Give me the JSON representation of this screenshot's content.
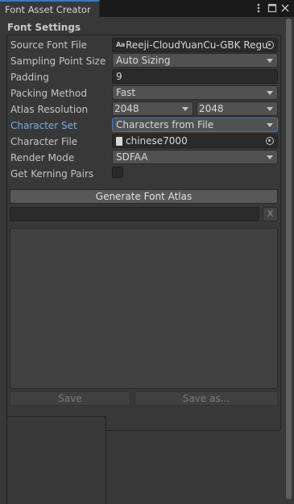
{
  "window": {
    "tab_title": "Font Asset Creator"
  },
  "section": {
    "title": "Font Settings"
  },
  "rows": {
    "source_font_file": {
      "label": "Source Font File",
      "value": "Reeji-CloudYuanCu-GBK Regu"
    },
    "sampling_point_size": {
      "label": "Sampling Point Size",
      "value": "Auto Sizing"
    },
    "padding": {
      "label": "Padding",
      "value": "9"
    },
    "packing_method": {
      "label": "Packing Method",
      "value": "Fast"
    },
    "atlas_resolution": {
      "label": "Atlas Resolution",
      "width": "2048",
      "height": "2048"
    },
    "character_set": {
      "label": "Character Set",
      "value": "Characters from File"
    },
    "character_file": {
      "label": "Character File",
      "value": "chinese7000"
    },
    "render_mode": {
      "label": "Render Mode",
      "value": "SDFAA"
    },
    "get_kerning_pairs": {
      "label": "Get Kerning Pairs",
      "checked": false
    }
  },
  "buttons": {
    "generate": "Generate Font Atlas",
    "clear": "X",
    "save": "Save",
    "save_as": "Save as..."
  },
  "icons": {
    "font_asset": "Aa"
  },
  "colors": {
    "accent": "#3a79bb",
    "highlight_label": "#7ba9e0",
    "panel_bg": "#383838"
  }
}
